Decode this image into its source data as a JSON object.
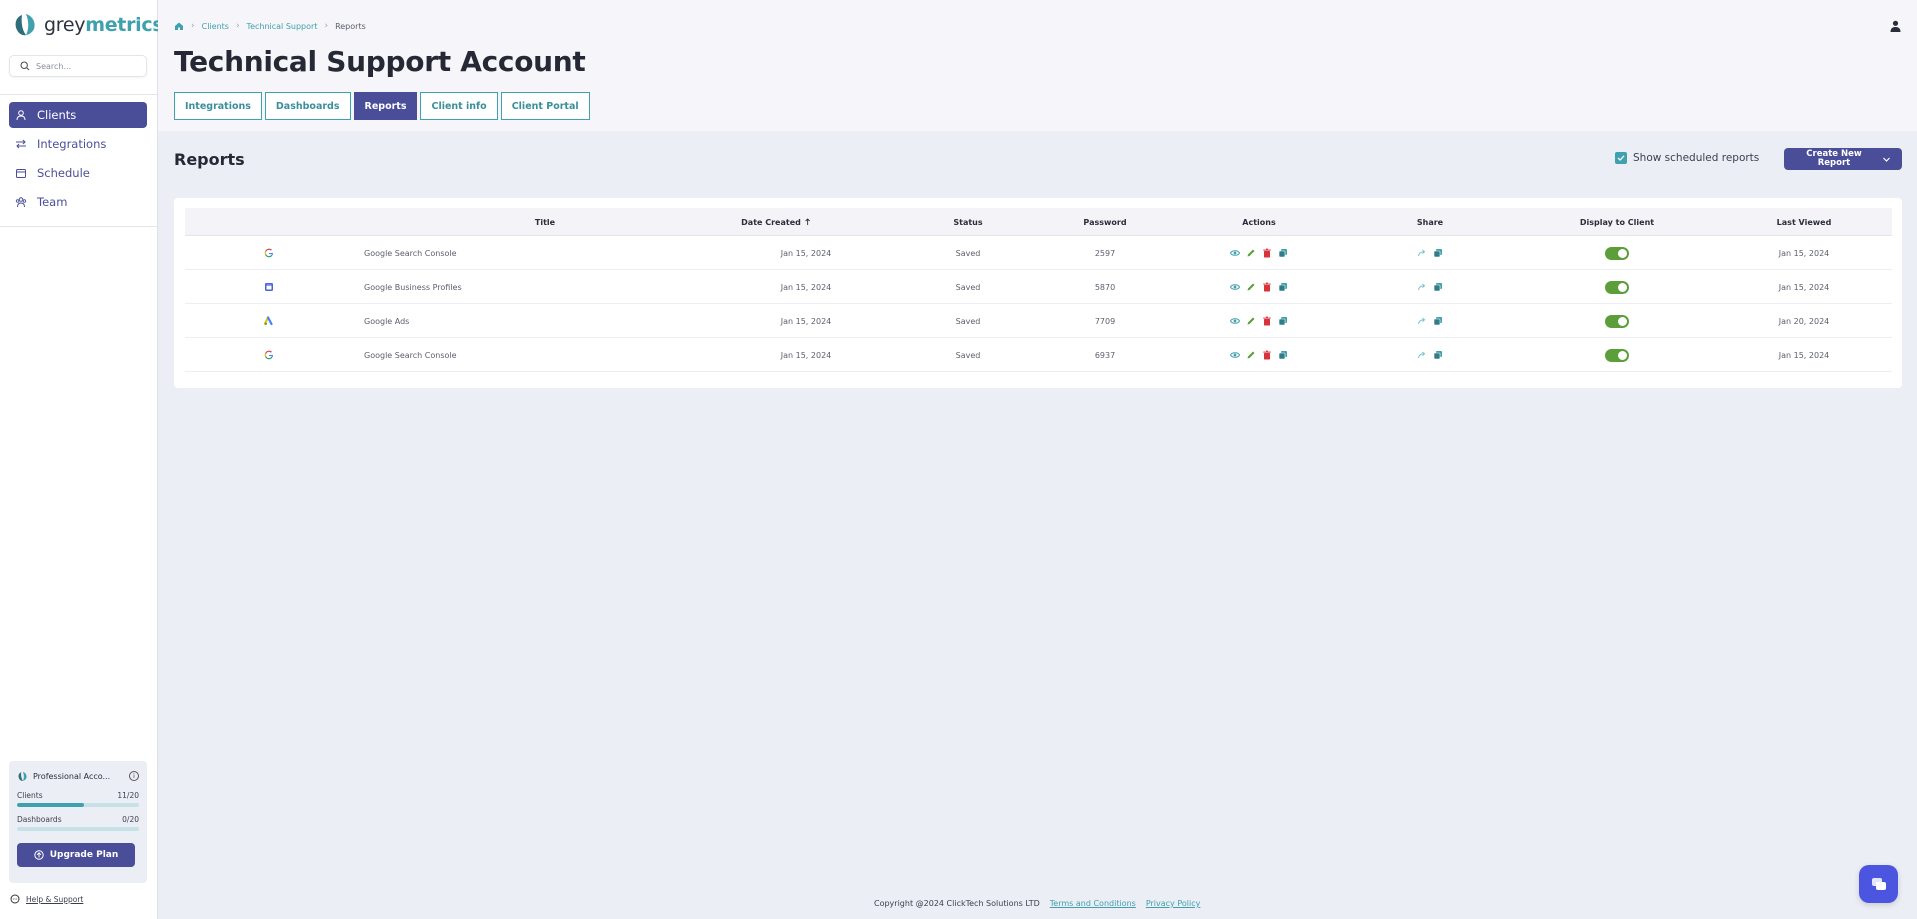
{
  "brand": {
    "grey": "grey",
    "metrics": "metrics",
    "accent": "#3fa0ae",
    "primary": "#4a4d98"
  },
  "search": {
    "placeholder": "Search..."
  },
  "nav": [
    {
      "label": "Clients",
      "icon": "person-icon",
      "active": true
    },
    {
      "label": "Integrations",
      "icon": "arrows-icon",
      "active": false
    },
    {
      "label": "Schedule",
      "icon": "calendar-icon",
      "active": false
    },
    {
      "label": "Team",
      "icon": "team-icon",
      "active": false
    }
  ],
  "plan": {
    "name": "Professional Acco...",
    "clients": {
      "label": "Clients",
      "value": "11/20",
      "fraction": 0.55
    },
    "dashboards": {
      "label": "Dashboards",
      "value": "0/20",
      "fraction": 0
    },
    "upgrade_label": "Upgrade Plan"
  },
  "help_label": "Help & Support",
  "breadcrumb": {
    "clients": "Clients",
    "account": "Technical Support",
    "current": "Reports"
  },
  "page_title": "Technical Support Account",
  "tabs": [
    "Integrations",
    "Dashboards",
    "Reports",
    "Client info",
    "Client Portal"
  ],
  "active_tab": "Reports",
  "section_title": "Reports",
  "show_scheduled_label": "Show scheduled reports",
  "show_scheduled_checked": true,
  "create_label": "Create New Report",
  "columns": {
    "title": "Title",
    "date_created": "Date Created",
    "status": "Status",
    "password": "Password",
    "actions": "Actions",
    "share": "Share",
    "display": "Display to Client",
    "last_viewed": "Last Viewed"
  },
  "rows": [
    {
      "source_icon": "google-icon",
      "title": "Google Search Console",
      "date": "Jan 15, 2024",
      "status": "Saved",
      "password": "2597",
      "display": true,
      "last_viewed": "Jan 15, 2024"
    },
    {
      "source_icon": "google-business-icon",
      "title": "Google Business Profiles",
      "date": "Jan 15, 2024",
      "status": "Saved",
      "password": "5870",
      "display": true,
      "last_viewed": "Jan 15, 2024"
    },
    {
      "source_icon": "google-ads-icon",
      "title": "Google Ads",
      "date": "Jan 15, 2024",
      "status": "Saved",
      "password": "7709",
      "display": true,
      "last_viewed": "Jan 20, 2024"
    },
    {
      "source_icon": "google-icon",
      "title": "Google Search Console",
      "date": "Jan 15, 2024",
      "status": "Saved",
      "password": "6937",
      "display": true,
      "last_viewed": "Jan 15, 2024"
    }
  ],
  "footer": {
    "copyright": "Copyright @2024 ClickTech Solutions LTD",
    "terms": "Terms and Conditions",
    "privacy": "Privacy Policy"
  }
}
